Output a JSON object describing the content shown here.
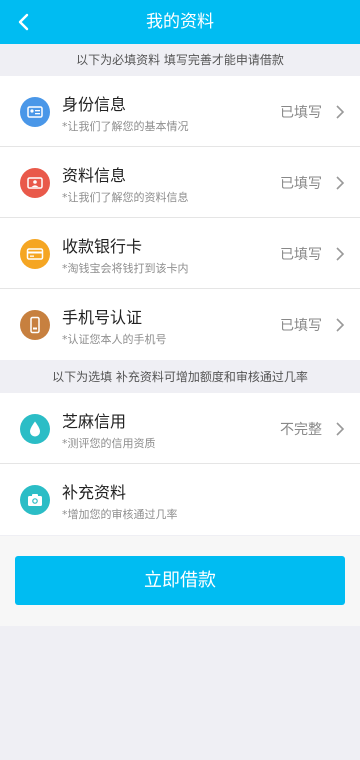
{
  "header": {
    "title": "我的资料"
  },
  "section_required": "以下为必填资料 填写完善才能申请借款",
  "required_items": [
    {
      "label": "身份信息",
      "sub": "*让我们了解您的基本情况",
      "status": "已填写"
    },
    {
      "label": "资料信息",
      "sub": "*让我们了解您的资料信息",
      "status": "已填写"
    },
    {
      "label": "收款银行卡",
      "sub": "*淘钱宝会将钱打到该卡内",
      "status": "已填写"
    },
    {
      "label": "手机号认证",
      "sub": "*认证您本人的手机号",
      "status": "已填写"
    }
  ],
  "section_optional": "以下为选填 补充资料可增加额度和审核通过几率",
  "optional_items": [
    {
      "label": "芝麻信用",
      "sub": "*测评您的信用资质",
      "status": "不完整"
    },
    {
      "label": "补充资料",
      "sub": "*增加您的审核通过几率",
      "status": ""
    }
  ],
  "submit_label": "立即借款",
  "colors": {
    "accent": "#00bcf2",
    "id_icon": "#4a97e8",
    "profile_icon": "#e9594a",
    "bank_icon": "#f5a623",
    "phone_icon": "#c7803f",
    "sesame_icon": "#2bbdc6",
    "extra_icon": "#2bbdc6"
  },
  "icons": {
    "back": "chevron-left-icon",
    "id": "id-card-icon",
    "profile": "profile-card-icon",
    "bank": "bank-card-icon",
    "phone": "phone-icon",
    "sesame": "water-drop-icon",
    "extra": "camera-icon",
    "row_arrow": "chevron-right-icon"
  }
}
